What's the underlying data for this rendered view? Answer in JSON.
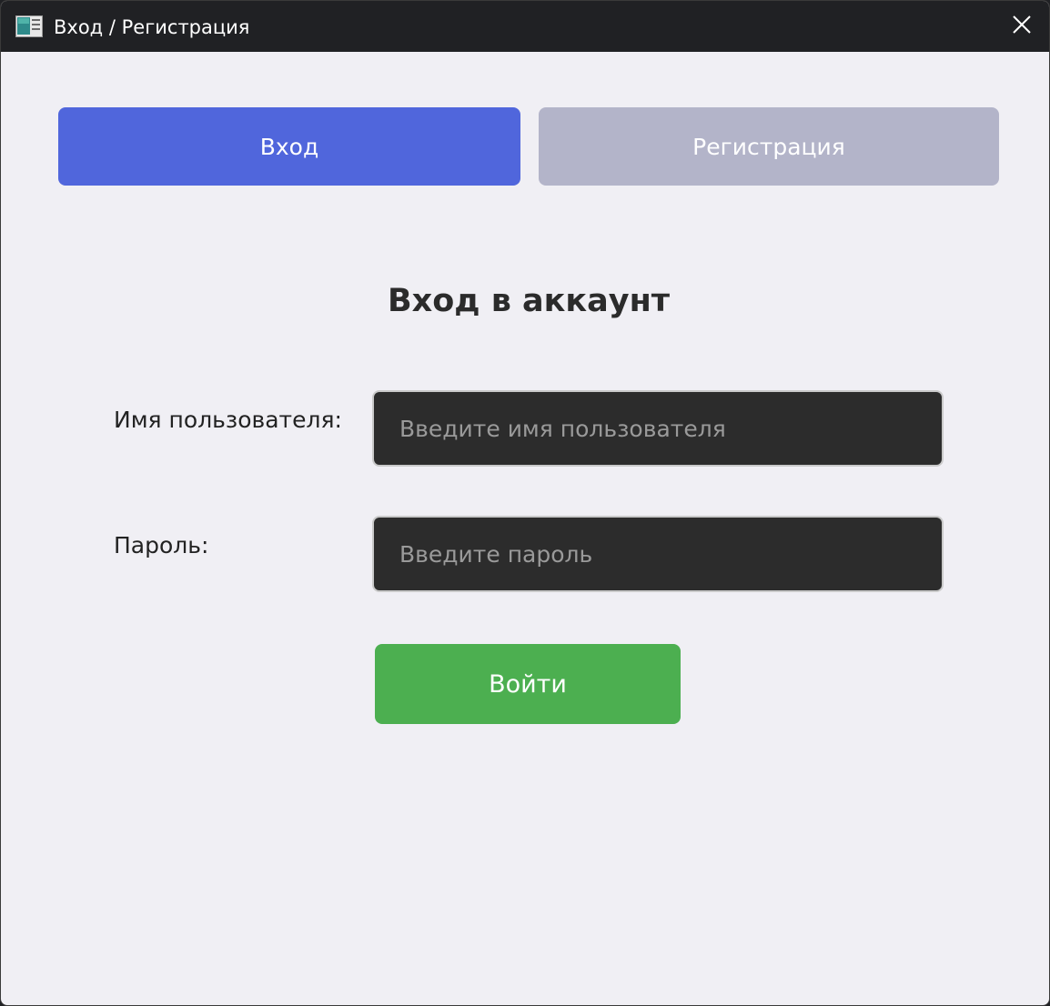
{
  "window": {
    "title": "Вход / Регистрация",
    "app_icon": "window-app-icon",
    "close_icon": "close-icon"
  },
  "tabs": [
    {
      "label": "Вход",
      "active": true,
      "color": "#5066dc"
    },
    {
      "label": "Регистрация",
      "active": false,
      "color": "#b3b4c9"
    }
  ],
  "form": {
    "title": "Вход в аккаунт",
    "username": {
      "label": "Имя пользователя:",
      "placeholder": "Введите имя пользователя",
      "value": ""
    },
    "password": {
      "label": "Пароль:",
      "placeholder": "Введите пароль",
      "value": ""
    },
    "submit_label": "Войти",
    "submit_color": "#4caf50"
  },
  "colors": {
    "background": "#f0eff4",
    "titlebar": "#202124",
    "input_background": "#2c2c2c"
  }
}
